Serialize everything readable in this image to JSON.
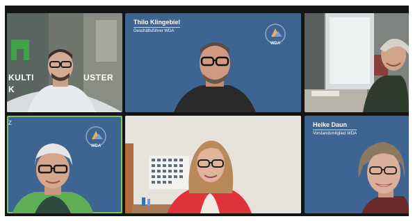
{
  "meeting": {
    "tiles": [
      {
        "id": "t1",
        "active": false,
        "sign_line1": "KULTI",
        "sign_line2": "K"
      },
      {
        "id": "t2",
        "active": false,
        "name": "Thilo Klingebiel",
        "role": "Geschäftsführer WDA",
        "logo": "WDA"
      },
      {
        "id": "t3",
        "active": false
      },
      {
        "id": "t4",
        "active": true,
        "partial_name": "Z",
        "logo": "WDA"
      },
      {
        "id": "t5",
        "active": false
      },
      {
        "id": "t6",
        "active": false,
        "name": "Heike Daun",
        "role": "Vorstandsmitglied WDA"
      }
    ]
  },
  "colors": {
    "tile_blue": "#3e6591",
    "active_speaker": "#7cc36a",
    "background": "#151515"
  }
}
